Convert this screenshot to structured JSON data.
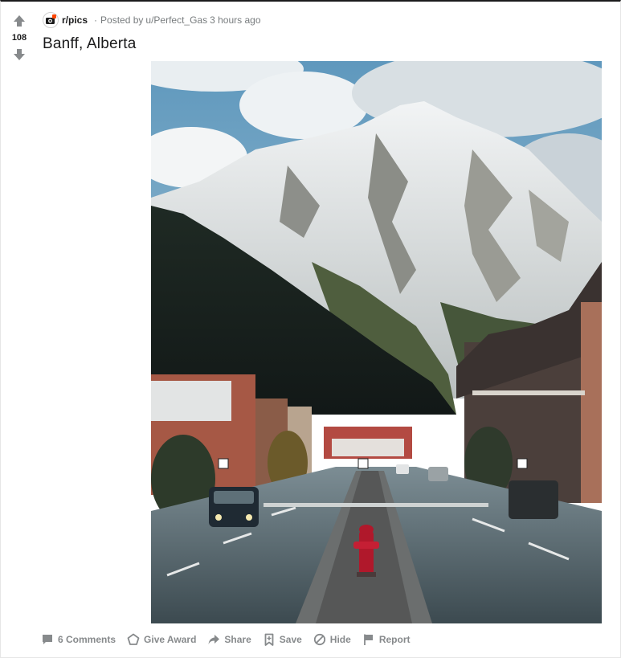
{
  "post": {
    "subreddit": "r/pics",
    "posted_by_prefix": "Posted by",
    "author": "u/Perfect_Gas",
    "time_ago": "3 hours ago",
    "votes": "108",
    "title": "Banff, Alberta"
  },
  "image": {
    "description_icon": "photo-banff-mountain-street"
  },
  "actions": {
    "comments": "6 Comments",
    "give_award": "Give Award",
    "share": "Share",
    "save": "Save",
    "hide": "Hide",
    "report": "Report"
  },
  "colors": {
    "text_primary": "#1a1a1b",
    "text_muted": "#787c7e",
    "action_gray": "#878a8c",
    "vote_gray": "#878a8c"
  },
  "icons": {
    "upvote": "upvote-arrow-icon",
    "downvote": "downvote-arrow-icon",
    "comments": "comment-icon",
    "award": "award-icon",
    "share": "share-arrow-icon",
    "save": "bookmark-icon",
    "hide": "hide-icon",
    "report": "flag-icon"
  }
}
